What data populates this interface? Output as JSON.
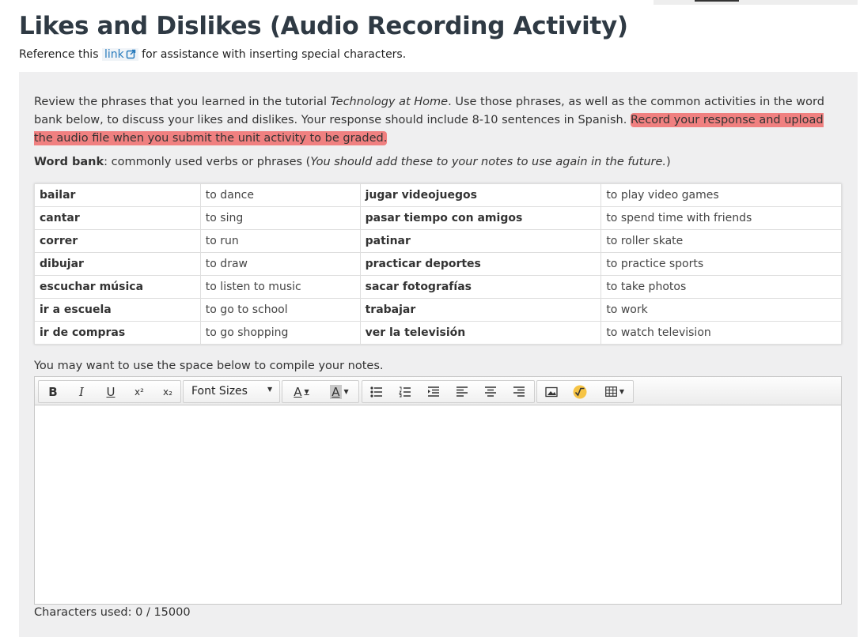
{
  "page": {
    "title": "Likes and Dislikes (Audio Recording Activity)",
    "reference_before": "Reference this",
    "reference_link": "link",
    "reference_after": "for assistance with inserting special characters."
  },
  "instructions": {
    "part1": "Review the phrases that you learned in the tutorial ",
    "tutorial_name": "Technology at Home",
    "part2": ".  Use those phrases, as well as the common activities in the word bank below, to discuss your likes and dislikes.  Your response should include 8-10 sentences in Spanish. ",
    "highlight": "Record your response and upload the audio file when you submit the unit activity to be graded."
  },
  "word_bank": {
    "label": "Word bank",
    "desc": ": commonly used verbs or phrases (",
    "note": "You should add these to your notes to use again in the future.",
    "close": ")",
    "rows": [
      [
        "bailar",
        "to dance",
        "jugar videojuegos",
        "to play video games"
      ],
      [
        "cantar",
        "to sing",
        "pasar tiempo con amigos",
        "to spend time with friends"
      ],
      [
        "correr",
        "to run",
        "patinar",
        "to roller skate"
      ],
      [
        "dibujar",
        "to draw",
        "practicar deportes",
        "to practice sports"
      ],
      [
        "escuchar música",
        "to listen to music",
        "sacar fotografías",
        "to take photos"
      ],
      [
        "ir a escuela",
        "to go to school",
        "trabajar",
        "to work"
      ],
      [
        "ir de compras",
        "to go shopping",
        "ver la televisión",
        "to watch television"
      ]
    ]
  },
  "notes": {
    "label": "You may want to use the space below to compile your notes.",
    "toolbar": {
      "bold": "B",
      "italic": "I",
      "underline": "U",
      "superscript": "x²",
      "subscript": "x₂",
      "font_sizes": "Font Sizes",
      "font_color": "A",
      "highlight_color": "A"
    },
    "editor_value": "",
    "characters_used": "Characters used: 0 / 15000"
  },
  "icons": [
    "external-link-icon",
    "bullet-list-icon",
    "numbered-list-icon",
    "indent-icon",
    "align-left-icon",
    "align-center-icon",
    "align-right-icon",
    "image-icon",
    "math-icon",
    "table-icon"
  ],
  "colors": {
    "highlight": "#f08080",
    "link": "#2a7cbd",
    "title": "#2f3a44",
    "panel": "#efeff0"
  }
}
